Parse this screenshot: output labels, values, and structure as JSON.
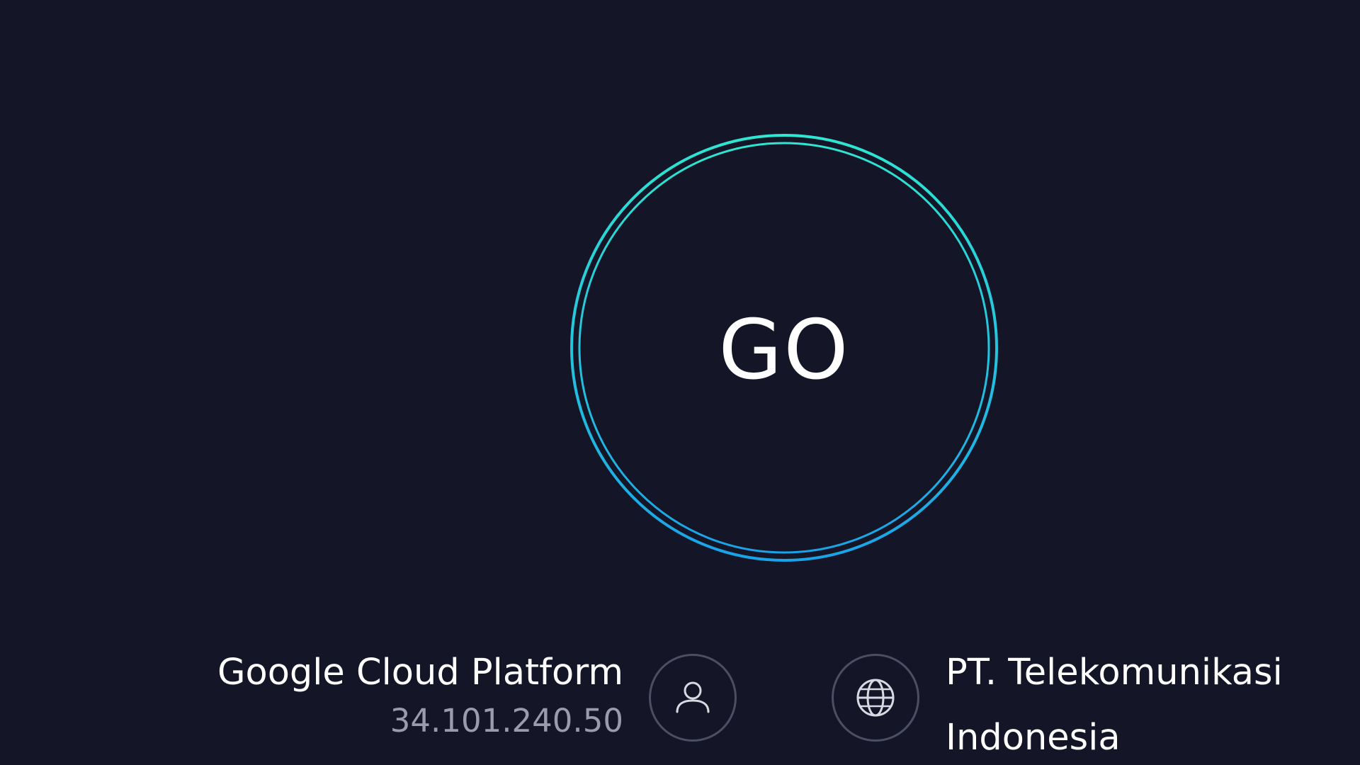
{
  "go_button": {
    "label": "GO",
    "ring_color_top": "#2ee6d2",
    "ring_color_bottom": "#1aa3e8"
  },
  "host": {
    "name": "Google Cloud Platform",
    "ip": "34.101.240.50",
    "icon": "user-icon"
  },
  "provider": {
    "name": "PT. Telekomunikasi Indonesia",
    "icon": "globe-icon"
  },
  "colors": {
    "background": "#141526",
    "muted_text": "#9a9cad",
    "icon_border": "#4c4e61"
  }
}
